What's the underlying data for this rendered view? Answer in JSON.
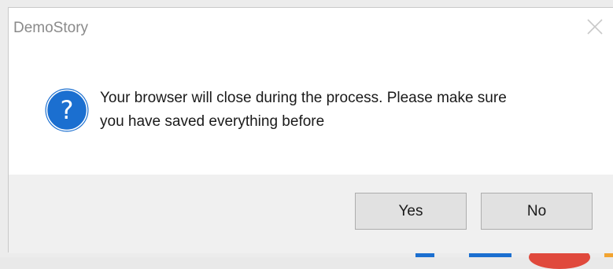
{
  "dialog": {
    "title": "DemoStory",
    "close_icon": "close-icon",
    "message_icon": "question-icon",
    "message": "Your browser will close during the process. Please make sure you have saved everything before",
    "message_lines": [
      "Your browser will close during the process. Please make sure",
      "you have saved everything before"
    ],
    "buttons": {
      "yes_label": "Yes",
      "no_label": "No"
    }
  },
  "colors": {
    "icon_blue": "#1b6fd0",
    "title_gray": "#8a8a8a",
    "button_bar_bg": "#f0f0f0",
    "button_bg": "#e1e1e1"
  }
}
